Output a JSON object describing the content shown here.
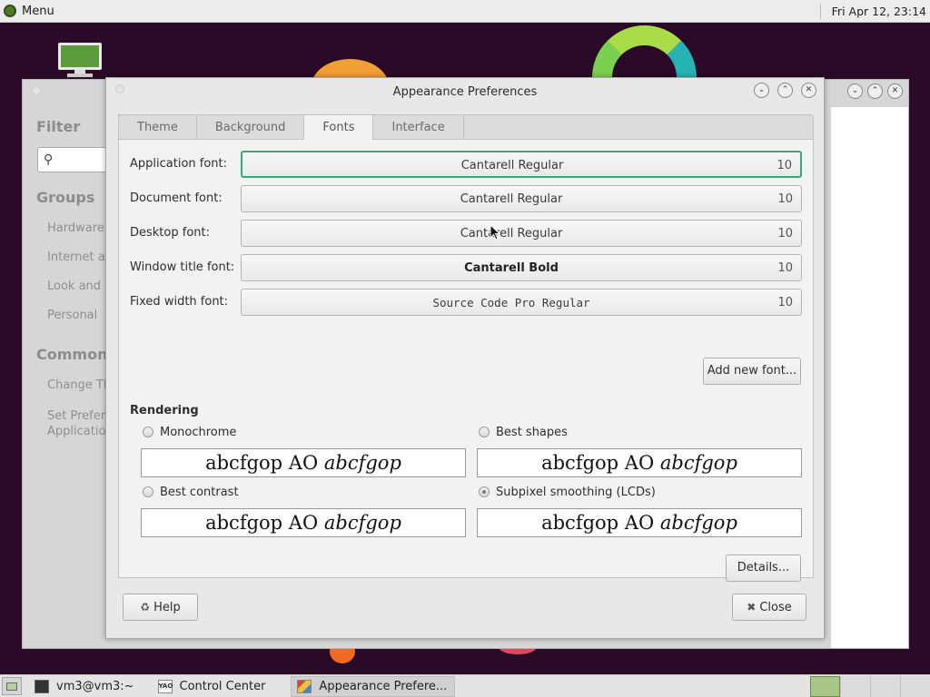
{
  "top_panel": {
    "menu_label": "Menu",
    "clock": "Fri Apr 12, 23:14"
  },
  "control_center": {
    "filter_heading": "Filter",
    "groups_heading": "Groups",
    "groups": [
      "Hardware",
      "Internet ar",
      "Look and F",
      "Personal"
    ],
    "common_heading": "Common T",
    "common_items": [
      "Change Th",
      "Set Prefer",
      "Application"
    ]
  },
  "dialog": {
    "title": "Appearance Preferences",
    "tabs": [
      {
        "label": "Theme",
        "active": false
      },
      {
        "label": "Background",
        "active": false
      },
      {
        "label": "Fonts",
        "active": true
      },
      {
        "label": "Interface",
        "active": false
      }
    ],
    "fonts": [
      {
        "label": "Application font:",
        "name": "Cantarell Regular",
        "size": "10"
      },
      {
        "label": "Document font:",
        "name": "Cantarell Regular",
        "size": "10"
      },
      {
        "label": "Desktop font:",
        "name": "Cantarell Regular",
        "size": "10"
      },
      {
        "label": "Window title font:",
        "name": "Cantarell Bold",
        "size": "10"
      },
      {
        "label": "Fixed width font:",
        "name": "Source Code Pro Regular",
        "size": "10"
      }
    ],
    "add_font_label": "Add new font...",
    "rendering_heading": "Rendering",
    "rendering_options": [
      {
        "label": "Monochrome",
        "selected": false
      },
      {
        "label": "Best shapes",
        "selected": false
      },
      {
        "label": "Best contrast",
        "selected": false
      },
      {
        "label": "Subpixel smoothing (LCDs)",
        "selected": true
      }
    ],
    "preview_text_normal": "abcfgop AO ",
    "preview_text_italic": "abcfgop",
    "details_label": "Details...",
    "help_label": "Help",
    "close_label": "Close"
  },
  "taskbar": {
    "items": [
      {
        "label": "vm3@vm3:~",
        "icon": "terminal-icon",
        "active": false
      },
      {
        "label": "Control Center",
        "icon": "control-center-icon",
        "active": false
      },
      {
        "label": "Appearance Prefere...",
        "icon": "appearance-icon",
        "active": true
      }
    ],
    "control_center_icon_text": "YAO",
    "workspace_count": 4,
    "current_workspace": 1
  },
  "colors": {
    "desktop_background": "#2a0a26",
    "focus_ring": "#34a87d",
    "workspace_current": "#a9c689"
  }
}
